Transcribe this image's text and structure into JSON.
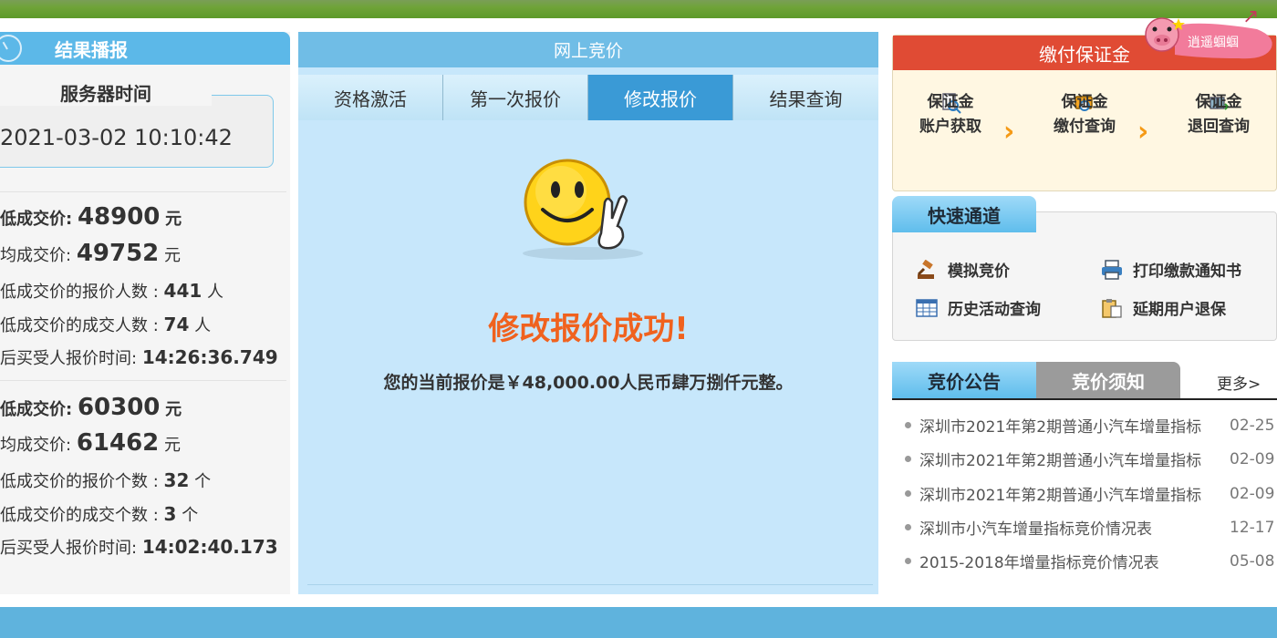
{
  "left": {
    "title": "结果播报",
    "server_time_label": "服务器时间",
    "server_time": "2021-03-02 10:10:42",
    "personal": {
      "min_price_label": "低成交价:",
      "min_price": "48900",
      "unit_yuan": "元",
      "avg_price_label": "均成交价:",
      "avg_price": "49752",
      "bidders_label": "低成交价的报价人数 :",
      "bidders": "441",
      "unit_person": "人",
      "deals_label": "低成交价的成交人数 :",
      "deals": "74",
      "last_time_label": "后买受人报价时间:",
      "last_time": "14:26:36.749"
    },
    "company": {
      "min_price_label": "低成交价:",
      "min_price": "60300",
      "unit_yuan": "元",
      "avg_price_label": "均成交价:",
      "avg_price": "61462",
      "bidders_label": "低成交价的报价个数 :",
      "bidders": "32",
      "unit_count": "个",
      "deals_label": "低成交价的成交个数 :",
      "deals": "3",
      "last_time_label": "后买受人报价时间:",
      "last_time": "14:02:40.173"
    }
  },
  "center": {
    "title": "网上竞价",
    "tabs": [
      "资格激活",
      "第一次报价",
      "修改报价",
      "结果查询"
    ],
    "active_tab": "修改报价",
    "success_title": "修改报价成功!",
    "success_msg": "您的当前报价是￥48,000.00人民币肆万捌仟元整。"
  },
  "right": {
    "deposit_title": "缴付保证金",
    "deposit_items": [
      {
        "line1": "保证金",
        "line2": "账户获取"
      },
      {
        "line1": "保证金",
        "line2": "缴付查询"
      },
      {
        "line1": "保证金",
        "line2": "退回查询"
      }
    ],
    "pig_label": "逍遥蝈蝈",
    "quick_title": "快速通道",
    "quick_items": [
      "模拟竞价",
      "打印缴款通知书",
      "历史活动查询",
      "延期用户退保"
    ],
    "notice_tab": "竞价公告",
    "rules_tab": "竞价须知",
    "more": "更多>",
    "notices": [
      {
        "title": "深圳市2021年第2期普通小汽车增量指标",
        "date": "02-25"
      },
      {
        "title": "深圳市2021年第2期普通小汽车增量指标",
        "date": "02-09"
      },
      {
        "title": "深圳市2021年第2期普通小汽车增量指标",
        "date": "02-09"
      },
      {
        "title": "深圳市小汽车增量指标竞价情况表",
        "date": "12-17"
      },
      {
        "title": "2015-2018年增量指标竞价情况表",
        "date": "05-08"
      }
    ]
  },
  "colors": {
    "accent_blue": "#5cb8e8",
    "tab_active": "#3a9ad6",
    "success_orange": "#f0621e",
    "deposit_red": "#e04b34"
  }
}
